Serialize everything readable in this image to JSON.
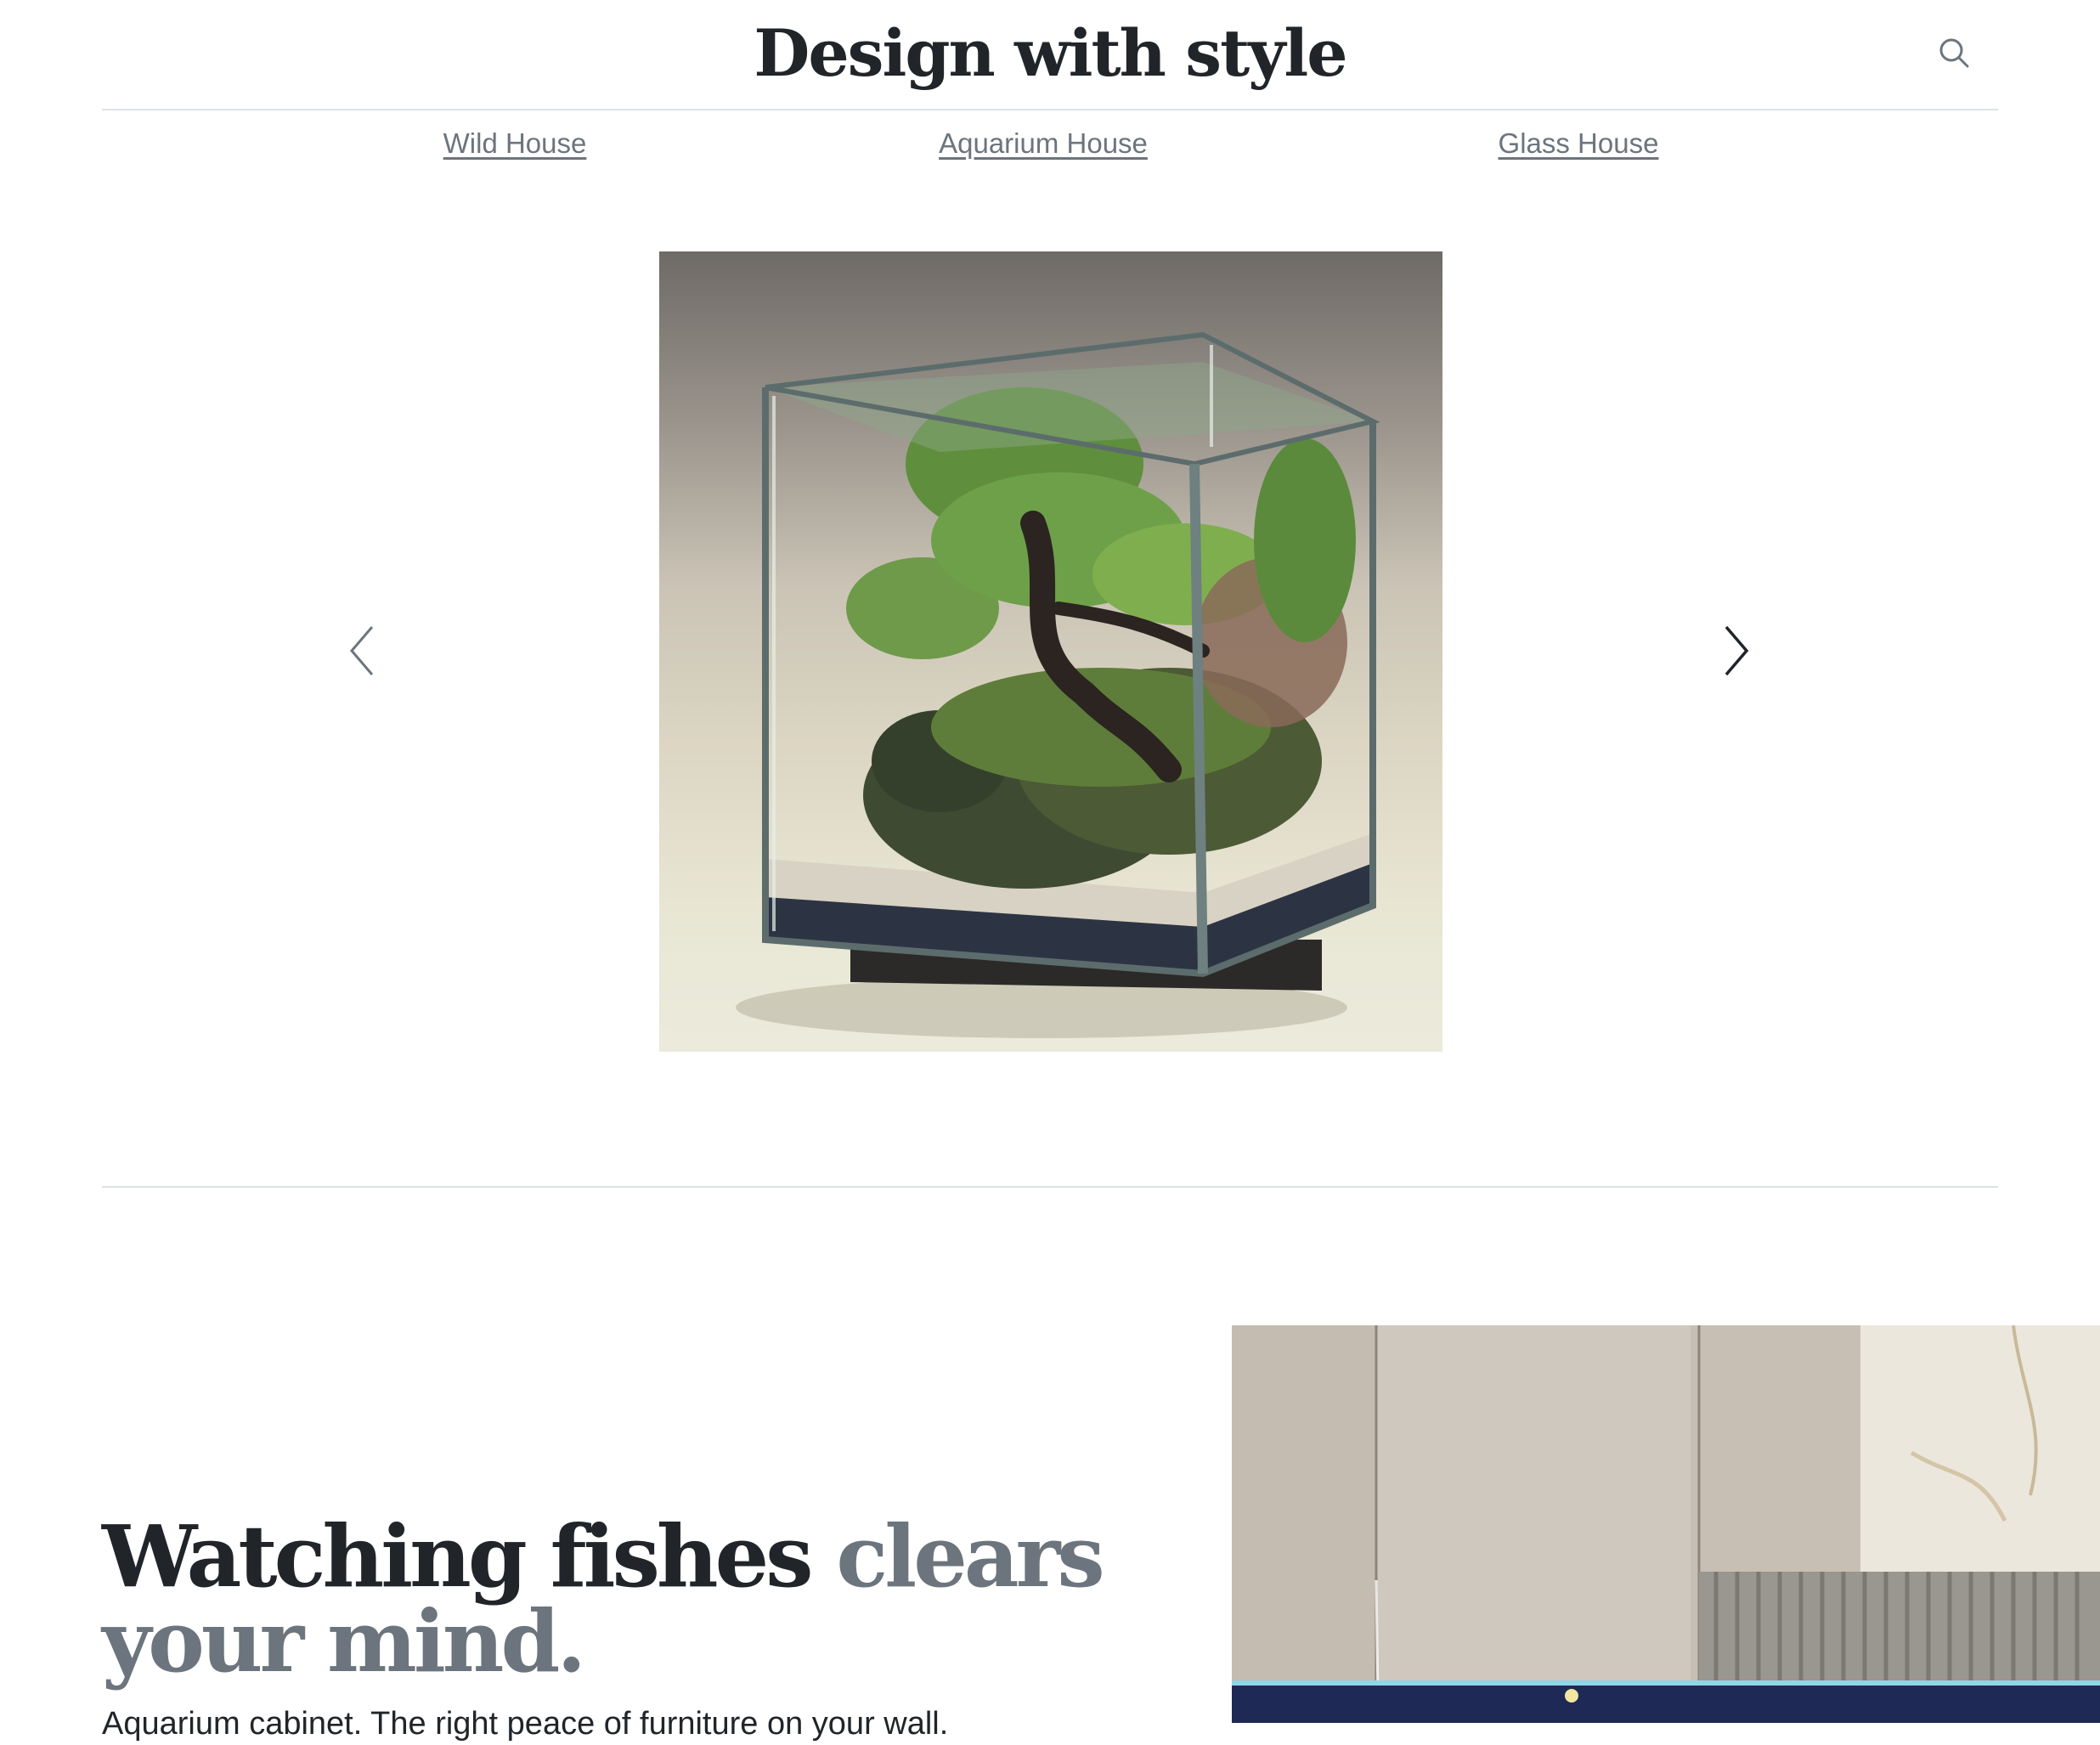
{
  "header": {
    "title": "Design with style",
    "search_icon": "search-icon"
  },
  "nav": {
    "links": [
      {
        "label": "Wild House"
      },
      {
        "label": "Aquarium House"
      },
      {
        "label": "Glass House"
      }
    ]
  },
  "carousel": {
    "prev_icon": "chevron-left-icon",
    "next_icon": "chevron-right-icon",
    "slide": {
      "subject": "bonsai aquarium"
    }
  },
  "feature": {
    "heading_strong": "Watching fishes",
    "heading_muted": "clears your mind.",
    "lead": "Aquarium cabinet. The right peace of furniture on your wall."
  },
  "colors": {
    "text": "#212529",
    "muted": "#6c757d",
    "rule": "#dee2e6",
    "background": "#ffffff"
  }
}
